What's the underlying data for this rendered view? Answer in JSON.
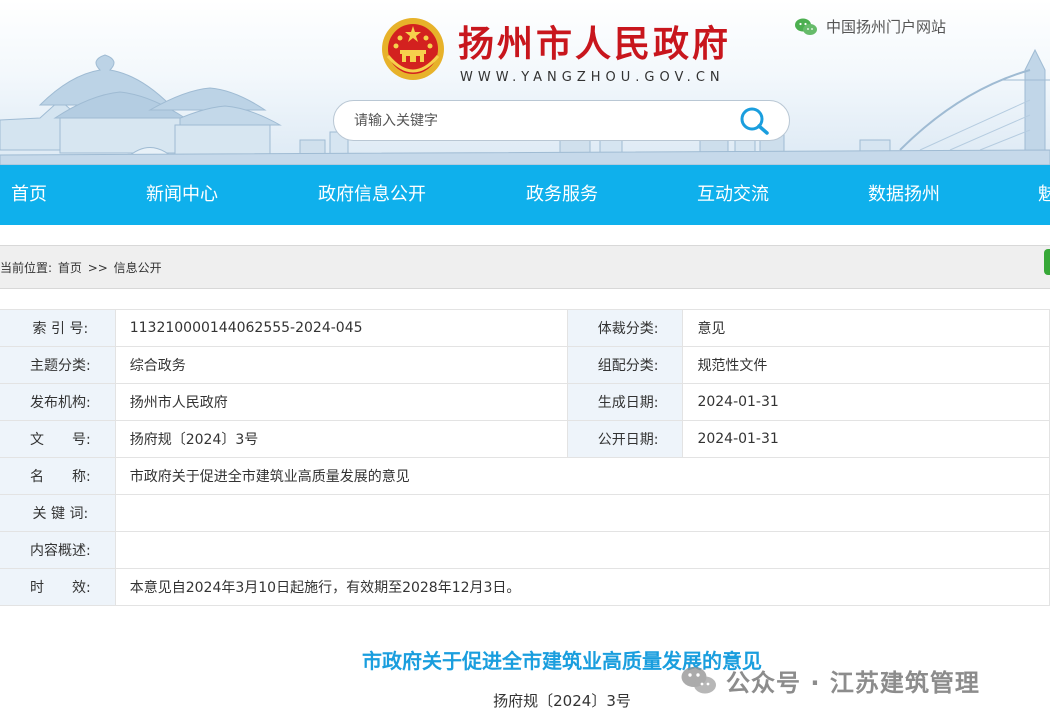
{
  "header": {
    "site_title": "扬州市人民政府",
    "site_url": "WWW.YANGZHOU.GOV.CN",
    "portal_link": "中国扬州门户网站",
    "brand_red": "#c8161d"
  },
  "search": {
    "placeholder": "请输入关键字"
  },
  "nav": {
    "color": "#0fb0ec",
    "items": [
      "首页",
      "新闻中心",
      "政府信息公开",
      "政务服务",
      "互动交流",
      "数据扬州",
      "魅"
    ]
  },
  "breadcrumb": {
    "prefix": "当前位置:",
    "home": "首页",
    "sep": ">>",
    "current": "信息公开"
  },
  "meta": {
    "index_label": "索 引 号:",
    "index_value": "113210000144062555-2024-045",
    "genre_label": "体裁分类:",
    "genre_value": "意见",
    "topic_label": "主题分类:",
    "topic_value": "综合政务",
    "group_label": "组配分类:",
    "group_value": "规范性文件",
    "issuer_label": "发布机构:",
    "issuer_value": "扬州市人民政府",
    "created_label": "生成日期:",
    "created_value": "2024-01-31",
    "docno_label_a": "文",
    "docno_label_b": "号:",
    "docno_value": "扬府规〔2024〕3号",
    "public_label": "公开日期:",
    "public_value": "2024-01-31",
    "name_label_a": "名",
    "name_label_b": "称:",
    "name_value": "市政府关于促进全市建筑业高质量发展的意见",
    "keywords_label": "关 键 词:",
    "keywords_value": "",
    "summary_label": "内容概述:",
    "summary_value": "",
    "validity_label_a": "时",
    "validity_label_b": "效:",
    "validity_value": "本意见自2024年3月10日起施行，有效期至2028年12月3日。"
  },
  "article": {
    "title": "市政府关于促进全市建筑业高质量发展的意见",
    "doc_number": "扬府规〔2024〕3号",
    "title_color": "#1a9ede"
  },
  "watermark": {
    "text": "公众号 · 江苏建筑管理"
  }
}
